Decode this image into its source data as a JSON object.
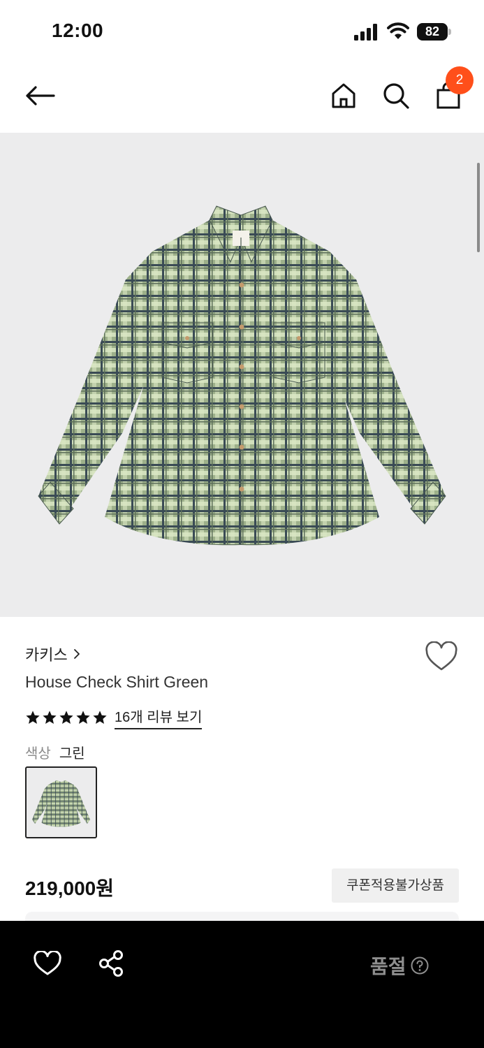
{
  "status_bar": {
    "time": "12:00",
    "battery": "82"
  },
  "nav": {
    "cart_count": "2"
  },
  "product": {
    "brand": "카키스",
    "name": "House Check Shirt Green",
    "rating": 5,
    "review_link": "16개 리뷰 보기",
    "color_label": "색상",
    "color_value": "그린",
    "price": "219,000원",
    "coupon_badge": "쿠폰적용불가상품"
  },
  "bottom_bar": {
    "status": "품절"
  },
  "colors": {
    "badge": "#ff4f1a",
    "image_bg": "#ececed",
    "bottom_bar": "#000000",
    "soldout_text": "#8e8e8e"
  },
  "icons": [
    "back-arrow-icon",
    "home-icon",
    "search-icon",
    "shopping-bag-icon",
    "heart-icon",
    "star-icon",
    "share-icon",
    "help-circle-icon",
    "chevron-right-icon"
  ]
}
